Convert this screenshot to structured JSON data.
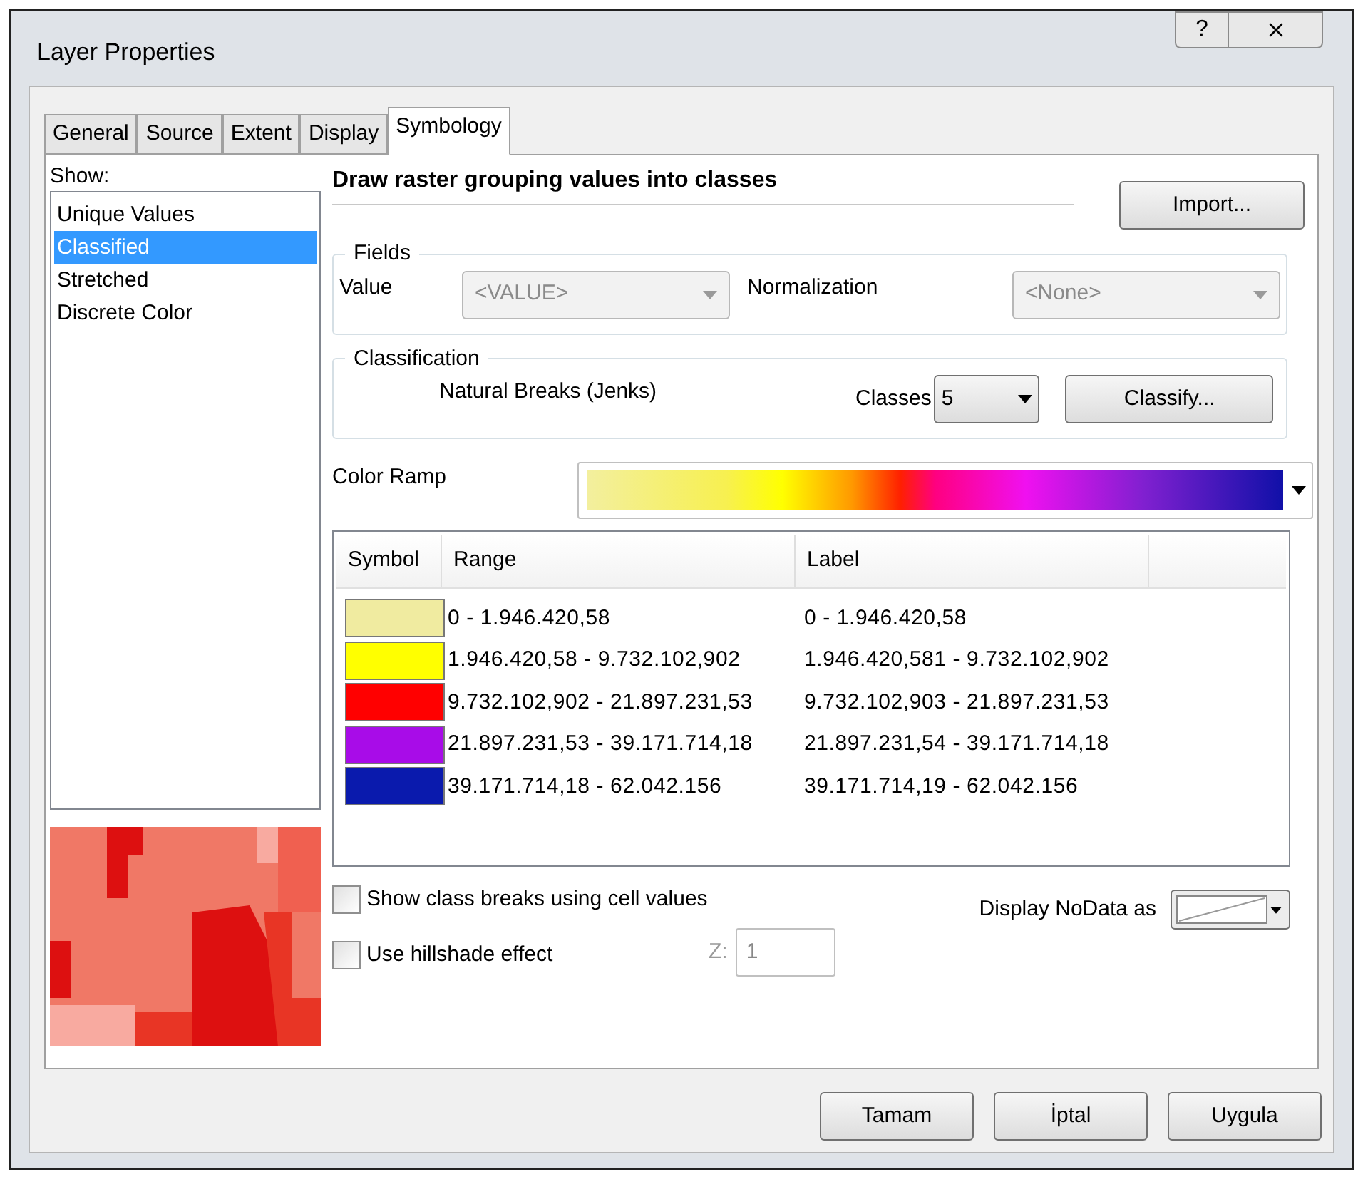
{
  "window": {
    "title": "Layer Properties",
    "help": "?"
  },
  "tabs": [
    {
      "label": "General",
      "selected": false
    },
    {
      "label": "Source",
      "selected": false
    },
    {
      "label": "Extent",
      "selected": false
    },
    {
      "label": "Display",
      "selected": false
    },
    {
      "label": "Symbology",
      "selected": true
    }
  ],
  "show": {
    "label": "Show:",
    "items": [
      {
        "label": "Unique Values",
        "selected": false
      },
      {
        "label": "Classified",
        "selected": true
      },
      {
        "label": "Stretched",
        "selected": false
      },
      {
        "label": "Discrete Color",
        "selected": false
      }
    ]
  },
  "heading": "Draw raster grouping values into classes",
  "import_button": "Import...",
  "fields": {
    "title": "Fields",
    "value_label": "Value",
    "value_select": {
      "value": "<VALUE>",
      "disabled": true
    },
    "normalization_label": "Normalization",
    "normalization_select": {
      "value": "<None>",
      "disabled": true
    }
  },
  "classification": {
    "title": "Classification",
    "method": "Natural Breaks (Jenks)",
    "classes_label": "Classes",
    "classes_value": "5",
    "classify_button": "Classify..."
  },
  "color_ramp": {
    "label": "Color Ramp"
  },
  "table": {
    "columns": [
      "Symbol",
      "Range",
      "Label"
    ],
    "rows": [
      {
        "color": "#f0eba0",
        "range": "0 - 1.946.420,58",
        "label": "0 - 1.946.420,58"
      },
      {
        "color": "#ffff00",
        "range": "1.946.420,58 - 9.732.102,902",
        "label": "1.946.420,581 - 9.732.102,902"
      },
      {
        "color": "#ff0000",
        "range": "9.732.102,902 - 21.897.231,53",
        "label": "9.732.102,903 - 21.897.231,53"
      },
      {
        "color": "#a80ce8",
        "range": "21.897.231,53 - 39.171.714,18",
        "label": "21.897.231,54 - 39.171.714,18"
      },
      {
        "color": "#0a1aad",
        "range": "39.171.714,18 - 62.042.156",
        "label": "39.171.714,19 - 62.042.156"
      }
    ]
  },
  "checkboxes": [
    {
      "label": "Show class breaks using cell values",
      "checked": false
    },
    {
      "label": "Use hillshade effect",
      "checked": false
    }
  ],
  "z_field": {
    "label": "Z:",
    "value": "1",
    "disabled": true
  },
  "nodata": {
    "label": "Display NoData as"
  },
  "buttons": [
    "Tamam",
    "İptal",
    "Uygula"
  ]
}
